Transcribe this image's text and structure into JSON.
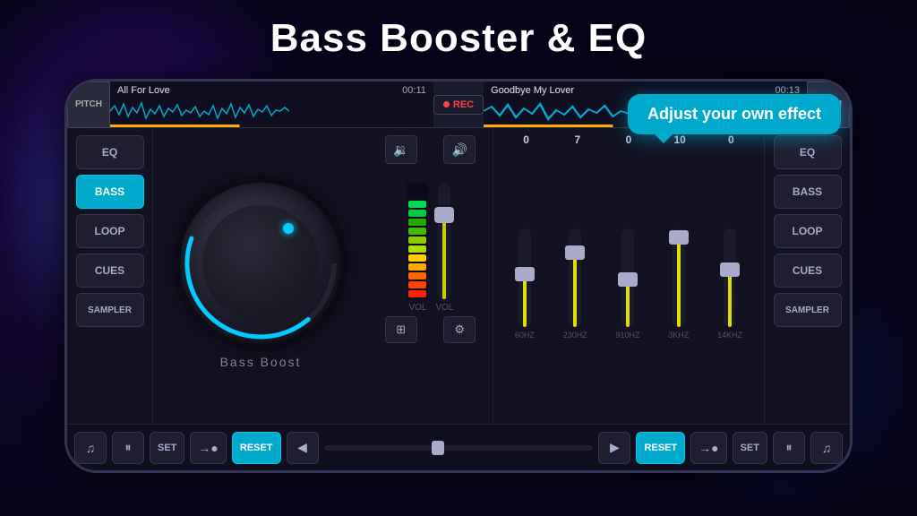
{
  "title": "Bass Booster & EQ",
  "header": {
    "pitch_label": "PITCH",
    "track_left": "All For Love",
    "time_left": "00:11",
    "rec_label": "REC",
    "track_right": "Goodbye My Lover",
    "time_right": "00:13"
  },
  "left_panel": {
    "eq_label": "EQ",
    "bass_label": "BASS",
    "loop_label": "LOOP",
    "cues_label": "CUES",
    "sampler_label": "SAMPLER"
  },
  "right_panel": {
    "eq_label": "EQ",
    "bass_label": "BASS",
    "loop_label": "LOOP",
    "cues_label": "CUES",
    "sampler_label": "SAMPLER"
  },
  "knob": {
    "label": "Bass Boost"
  },
  "eq": {
    "values": [
      "0",
      "7",
      "0",
      "10",
      "0"
    ],
    "freqs": [
      "60HZ",
      "230HZ",
      "910HZ",
      "3KHZ",
      "14KHZ"
    ],
    "fader_positions": [
      50,
      30,
      55,
      15,
      45
    ]
  },
  "transport": {
    "set_label": "SET",
    "reset_label": "RESET"
  },
  "tooltip": {
    "text": "Adjust your own effect"
  }
}
